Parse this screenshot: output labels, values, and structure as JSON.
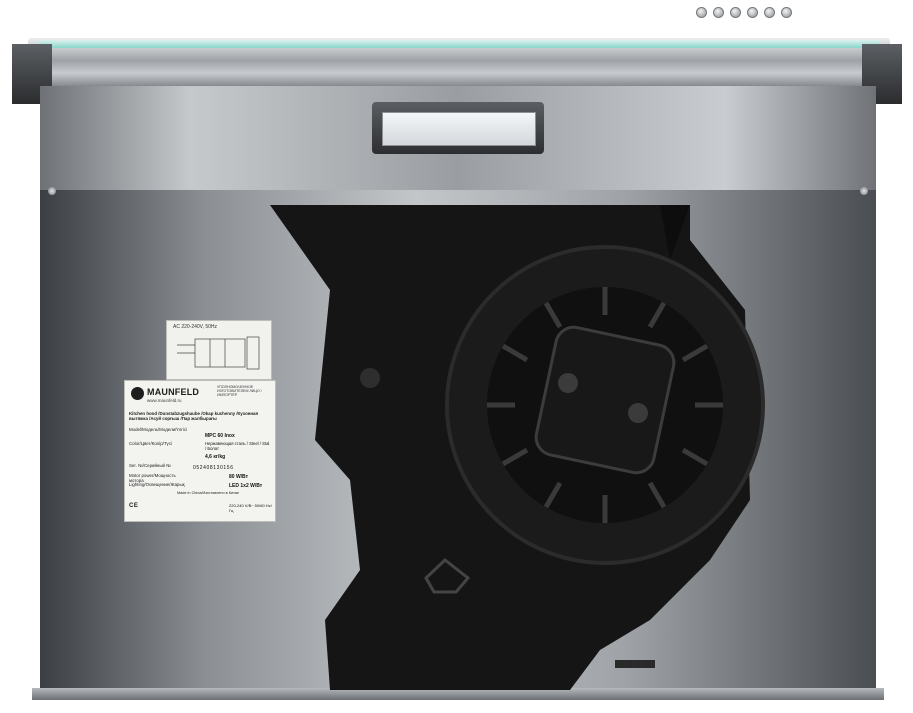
{
  "label_power": {
    "supply_text": "AC 220-240V, 50Hz"
  },
  "label_main": {
    "brand": "MAUNFELD",
    "brand_url": "www.maunfeld.ru",
    "importer": "УПОЛНОМОЧЕННОЕ ИЗГОТОВИТЕЛЕМ ЛИЦО / ИМПОРТЁР",
    "product": "Kitchen hood /Dunstabzugshaube /Okap kuchenny /Кухонная вытяжка /Асуй сорғыш /Пар жалбырағы",
    "model_label": "Model/Модель/Модели/Үлгісі",
    "model_value": "MPC 60 Inox",
    "color_label": "Color/Цвет/Колір/Түсі",
    "color_value": "Нержавеющая сталь / Steel / Stal / Болат",
    "weight_value": "4,6 кг/kg",
    "serial_label": "Ser. №/Серийный №",
    "serial_value": "052408130156",
    "motor_label": "Motor power/Мощность мотора",
    "motor_value": "80 W/Вт",
    "lighting_label": "Lighting/Освещение/Жарық",
    "lighting_value": "LED 1x2 W/Вт",
    "made_in": "Made in China/Изготовлено в Китае",
    "voltage_value": "220-240 V/В~ 50/60 Hz/Гц",
    "cert_marks": "CE"
  },
  "colors": {
    "steel_light": "#c6c9cc",
    "steel_dark": "#3b3e42",
    "motor_black": "#151515",
    "glass_accent": "#7fd8cc"
  }
}
